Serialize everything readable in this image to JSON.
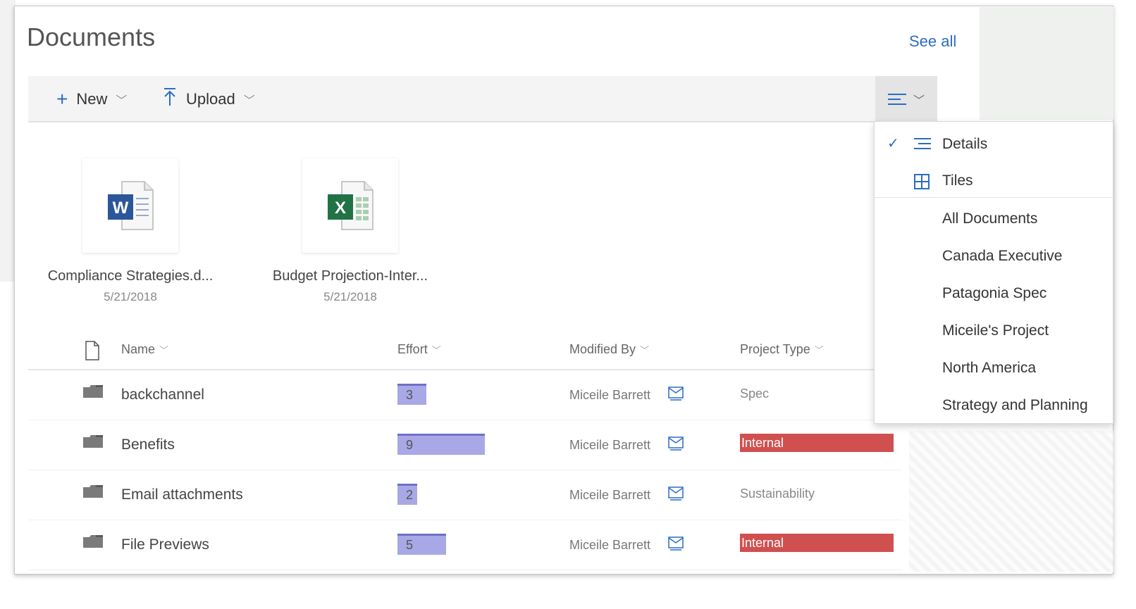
{
  "page": {
    "title": "Documents",
    "see_all": "See all"
  },
  "toolbar": {
    "new_label": "New",
    "upload_label": "Upload"
  },
  "tiles": [
    {
      "name": "Compliance Strategies.d...",
      "date": "5/21/2018",
      "type": "word"
    },
    {
      "name": "Budget Projection-Inter...",
      "date": "5/21/2018",
      "type": "excel"
    }
  ],
  "columns": {
    "name": "Name",
    "effort": "Effort",
    "modified_by": "Modified By",
    "project_type": "Project Type"
  },
  "rows": [
    {
      "name": "backchannel",
      "effort": "3",
      "modified_by": "Miceile Barrett",
      "project_type": "Spec"
    },
    {
      "name": "Benefits",
      "effort": "9",
      "modified_by": "Miceile Barrett",
      "project_type": "Internal"
    },
    {
      "name": "Email attachments",
      "effort": "2",
      "modified_by": "Miceile Barrett",
      "project_type": "Sustainability"
    },
    {
      "name": "File Previews",
      "effort": "5",
      "modified_by": "Miceile Barrett",
      "project_type": "Internal"
    }
  ],
  "view_menu": {
    "layouts": [
      {
        "label": "Details",
        "checked": true,
        "icon": "details-icon"
      },
      {
        "label": "Tiles",
        "checked": false,
        "icon": "tiles-icon"
      }
    ],
    "views": [
      "All Documents",
      "Canada Executive",
      "Patagonia Spec",
      "Miceile's Project",
      "North America",
      "Strategy and Planning"
    ]
  },
  "colors": {
    "accent": "#2b6cc4",
    "effort_bar": "#a8a8e6",
    "internal_badge": "#d0504f"
  }
}
